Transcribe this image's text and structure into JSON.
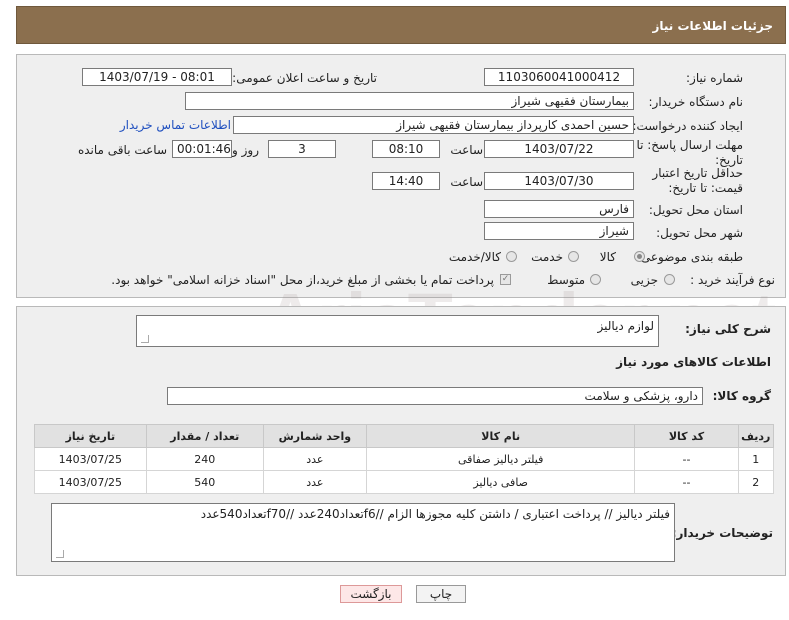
{
  "header": {
    "title": "جزئیات اطلاعات نیاز"
  },
  "form": {
    "need_number_label": "شماره نیاز:",
    "need_number_value": "1103060041000412",
    "announce_label": "تاریخ و ساعت اعلان عمومی:",
    "announce_value": "1403/07/19 - 08:01",
    "buyer_org_label": "نام دستگاه خریدار:",
    "buyer_org_value": "بیمارستان فقیهی شیراز",
    "creator_label": "ایجاد کننده درخواست:",
    "creator_value": "حسین احمدی کارپرداز بیمارستان فقیهی شیراز",
    "contact_link": "اطلاعات تماس خریدار",
    "reply_deadline_label": "مهلت ارسال پاسخ: تا تاریخ:",
    "reply_date": "1403/07/22",
    "time_label": "ساعت",
    "reply_time": "08:10",
    "days_value": "3",
    "days_label": "روز و",
    "remaining_value": "00:01:46",
    "remaining_label": "ساعت باقی مانده",
    "validity_label": "حداقل تاریخ اعتبار قیمت: تا تاریخ:",
    "validity_date": "1403/07/30",
    "validity_time_label": "ساعت",
    "validity_time": "14:40",
    "province_label": "استان محل تحویل:",
    "province_value": "فارس",
    "city_label": "شهر محل تحویل:",
    "city_value": "شیراز",
    "category_label": "طبقه بندی موضوعی:",
    "category_options": [
      "کالا",
      "خدمت",
      "کالا/خدمت"
    ],
    "purchase_type_label": "نوع فرآیند خرید :",
    "purchase_options": [
      "جزیی",
      "متوسط"
    ],
    "payment_note": "پرداخت تمام یا بخشی از مبلغ خرید،از محل \"اسناد خزانه اسلامی\" خواهد بود."
  },
  "details": {
    "summary_label": "شرح کلی نیاز:",
    "summary_value": "لوازم دیالیز",
    "goods_info_title": "اطلاعات کالاهای مورد نیاز",
    "goods_group_label": "گروه کالا:",
    "goods_group_value": "دارو، پزشکی و سلامت",
    "table_headers": [
      "ردیف",
      "کد کالا",
      "نام کالا",
      "واحد شمارش",
      "تعداد / مقدار",
      "تاریخ نیاز"
    ],
    "rows": [
      [
        "1",
        "--",
        "فیلتر دیالیز صفاقی",
        "عدد",
        "240",
        "1403/07/25"
      ],
      [
        "2",
        "--",
        "صافی دیالیز",
        "عدد",
        "540",
        "1403/07/25"
      ]
    ],
    "buyer_notes_label": "توضیحات خریدار:",
    "buyer_notes_value": "فیلتر دیالیز // پرداخت اعتباری / داشتن کلیه مجوزها الزام //f6تعداد240عدد //f70تعداد540عدد"
  },
  "buttons": {
    "print": "چاپ",
    "back": "بازگشت"
  },
  "watermark": {
    "text": "AriaTender.net"
  },
  "colors": {
    "header_bg": "#8b6f4e",
    "panel_bg": "#efefef",
    "link": "#1f4fbf"
  }
}
